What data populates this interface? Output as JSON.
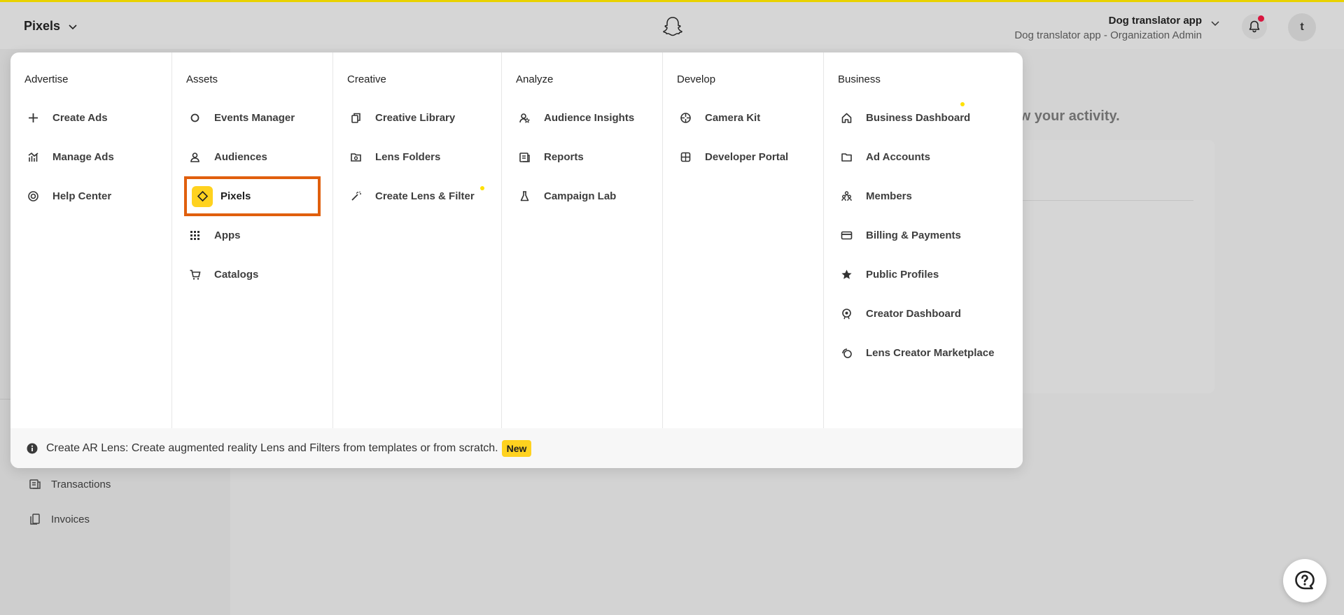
{
  "header": {
    "app_switcher_label": "Pixels",
    "org_name": "Dog translator app",
    "org_role": "Dog translator app - Organization Admin",
    "avatar_initial": "t",
    "notification_dot_color": "#d8163f"
  },
  "background": {
    "headline_fragment": "iew your activity.",
    "left_items": [
      {
        "label": "Transactions",
        "icon": "transactions-icon"
      },
      {
        "label": "Invoices",
        "icon": "invoices-icon"
      }
    ]
  },
  "menu": {
    "columns": [
      {
        "title": "Advertise",
        "items": [
          {
            "label": "Create Ads",
            "icon": "plus-icon"
          },
          {
            "label": "Manage Ads",
            "icon": "chart-icon"
          },
          {
            "label": "Help Center",
            "icon": "lifebuoy-icon"
          }
        ]
      },
      {
        "title": "Assets",
        "items": [
          {
            "label": "Events Manager",
            "icon": "circle-icon"
          },
          {
            "label": "Audiences",
            "icon": "person-icon"
          },
          {
            "label": "Pixels",
            "icon": "diamond-icon",
            "selected": true
          },
          {
            "label": "Apps",
            "icon": "grid-icon"
          },
          {
            "label": "Catalogs",
            "icon": "cart-icon"
          }
        ]
      },
      {
        "title": "Creative",
        "items": [
          {
            "label": "Creative Library",
            "icon": "library-icon"
          },
          {
            "label": "Lens Folders",
            "icon": "folder-camera-icon"
          },
          {
            "label": "Create Lens & Filter",
            "icon": "magic-wand-icon",
            "new_dot": true
          }
        ]
      },
      {
        "title": "Analyze",
        "items": [
          {
            "label": "Audience Insights",
            "icon": "audience-insights-icon"
          },
          {
            "label": "Reports",
            "icon": "reports-icon"
          },
          {
            "label": "Campaign Lab",
            "icon": "flask-icon"
          }
        ]
      },
      {
        "title": "Develop",
        "items": [
          {
            "label": "Camera Kit",
            "icon": "aperture-icon"
          },
          {
            "label": "Developer Portal",
            "icon": "developer-icon"
          }
        ]
      },
      {
        "title": "Business",
        "items": [
          {
            "label": "Business Dashboard",
            "icon": "home-icon",
            "new_dot": true
          },
          {
            "label": "Ad Accounts",
            "icon": "folder-icon"
          },
          {
            "label": "Members",
            "icon": "members-icon"
          },
          {
            "label": "Billing & Payments",
            "icon": "credit-card-icon"
          },
          {
            "label": "Public Profiles",
            "icon": "star-icon"
          },
          {
            "label": "Creator Dashboard",
            "icon": "creator-icon"
          },
          {
            "label": "Lens Creator Marketplace",
            "icon": "marketplace-icon"
          }
        ]
      }
    ],
    "footer": {
      "text": "Create AR Lens: Create augmented reality Lens and Filters from templates or from scratch.",
      "badge": "New"
    }
  },
  "colors": {
    "accent_yellow": "#ffd21f",
    "selection_outline": "#e05f0d"
  }
}
